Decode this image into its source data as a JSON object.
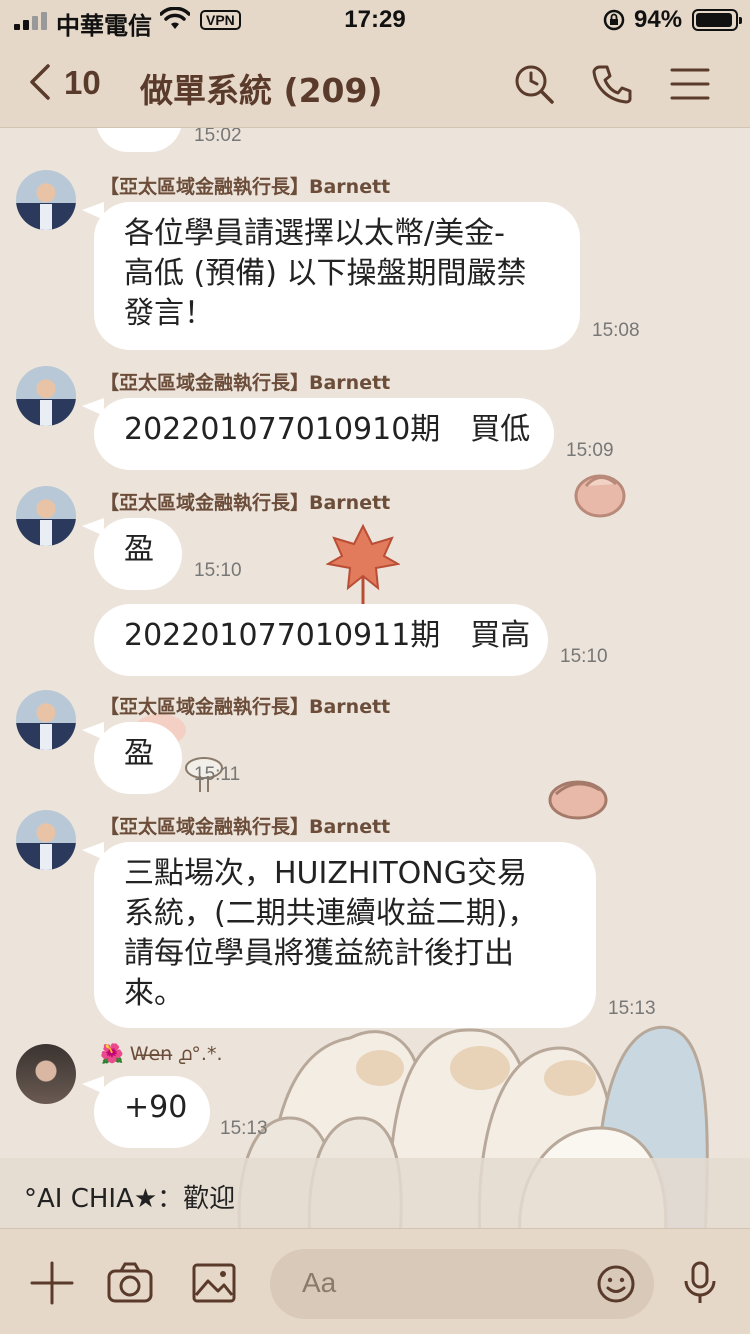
{
  "status_bar": {
    "carrier": "中華電信",
    "vpn": "VPN",
    "time": "17:29",
    "battery_percent": "94%",
    "battery_level": 0.94
  },
  "header": {
    "unread_count": "10",
    "title": "做單系統 (209)"
  },
  "messages": [
    {
      "time": "15:02"
    },
    {
      "sender": "【亞太區域金融執行長】Barnett",
      "lines": [
        "各位學員請選擇以太幣/美金-",
        "高低 (預備) 以下操盤期間嚴禁",
        "發言！"
      ],
      "time": "15:08"
    },
    {
      "sender": "【亞太區域金融執行長】Barnett",
      "lines": [
        "202201077010910期　買低"
      ],
      "time": "15:09"
    },
    {
      "sender": "【亞太區域金融執行長】Barnett",
      "lines": [
        "盈"
      ],
      "time": "15:10"
    },
    {
      "lines": [
        "202201077010911期　買高"
      ],
      "time": "15:10"
    },
    {
      "sender": "【亞太區域金融執行長】Barnett",
      "lines": [
        "盈"
      ],
      "time": "15:11"
    },
    {
      "sender": "【亞太區域金融執行長】Barnett",
      "lines": [
        "三點場次，HUIZHITONG交易",
        "系統，(二期共連續收益二期)，",
        "請每位學員將獲益統計後打出",
        "來。"
      ],
      "time": "15:13"
    },
    {
      "sender": "🌺 W̶e̶n̶ ൧°.*.",
      "lines": [
        "+90"
      ],
      "time": "15:13"
    }
  ],
  "notification": {
    "text": "°AI CHIA★：歡迎"
  },
  "input": {
    "placeholder": "Aa"
  }
}
